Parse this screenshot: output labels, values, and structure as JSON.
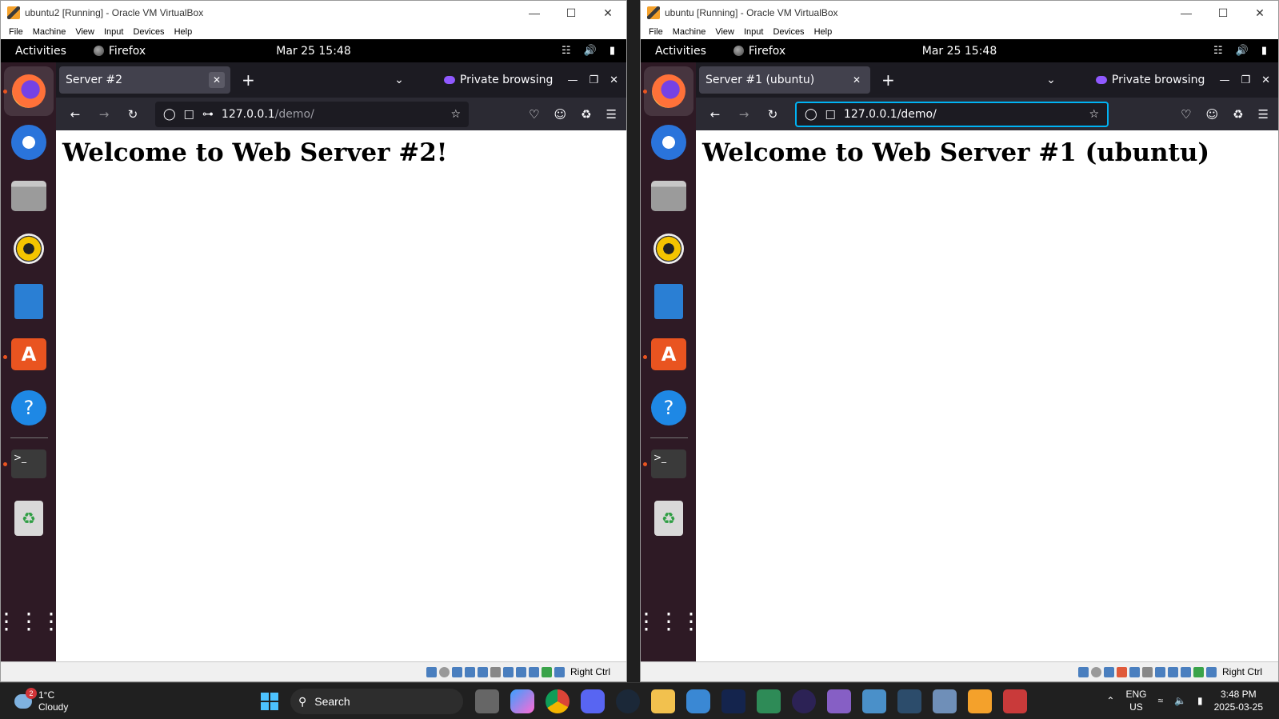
{
  "vms": [
    {
      "window_title": "ubuntu2 [Running] - Oracle VM VirtualBox",
      "menu": [
        "File",
        "Machine",
        "View",
        "Input",
        "Devices",
        "Help"
      ],
      "gnome": {
        "activities": "Activities",
        "app": "Firefox",
        "clock": "Mar 25  15:48"
      },
      "tab_title": "Server #2",
      "private_label": "Private browsing",
      "url_host": "127.0.0.1",
      "url_path": "/demo/",
      "heading": "Welcome to Web Server #2!",
      "host_key": "Right Ctrl"
    },
    {
      "window_title": "ubuntu [Running] - Oracle VM VirtualBox",
      "menu": [
        "File",
        "Machine",
        "View",
        "Input",
        "Devices",
        "Help"
      ],
      "gnome": {
        "activities": "Activities",
        "app": "Firefox",
        "clock": "Mar 25  15:48"
      },
      "tab_title": "Server #1 (ubuntu)",
      "private_label": "Private browsing",
      "url_host": "127.0.0.1",
      "url_path": "/demo/",
      "heading": "Welcome to Web Server #1 (ubuntu)",
      "host_key": "Right Ctrl"
    }
  ],
  "taskbar": {
    "weather": {
      "temp": "1°C",
      "condition": "Cloudy",
      "badge": "2"
    },
    "search_label": "Search",
    "lang": [
      "ENG",
      "US"
    ],
    "time": "3:48 PM",
    "date": "2025-03-25"
  },
  "colors": {
    "private_accent": "#9059ff",
    "ubuntu_orange": "#e95420",
    "url_focus": "#00b3f4"
  }
}
